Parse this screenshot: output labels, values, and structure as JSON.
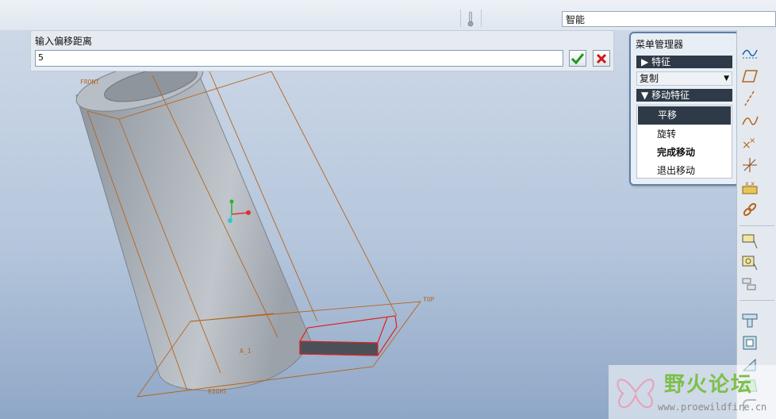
{
  "topbar": {
    "filter_value": "智能"
  },
  "offset_dialog": {
    "prompt": "输入偏移距离",
    "value": "5"
  },
  "menu_manager": {
    "title": "菜单管理器",
    "feature_header": "特征",
    "copy_option": "复制",
    "move_feature_header": "移动特征",
    "items": [
      {
        "label": "平移",
        "selected": true,
        "bold": false
      },
      {
        "label": "旋转",
        "selected": false,
        "bold": false
      },
      {
        "label": "完成移动",
        "selected": false,
        "bold": true
      },
      {
        "label": "退出移动",
        "selected": false,
        "bold": false
      }
    ]
  },
  "model": {
    "datum_labels": {
      "front": "FRONT",
      "top": "TOP",
      "right": "RIGHT",
      "axis": "A_1"
    }
  },
  "watermark": {
    "name": "野火论坛",
    "url": "www.proewildfire.cn"
  },
  "colors": {
    "datum_plane": "#b5651d",
    "highlight": "#e02020",
    "menu_dark": "#2f3a48",
    "accent_green": "#7dbf4a"
  },
  "icons": [
    "thermometer-icon",
    "check-icon",
    "close-icon",
    "sketch-curve-icon",
    "datum-plane-icon",
    "datum-axis-icon",
    "datum-curve-icon",
    "datum-point-icon",
    "coordinate-system-icon",
    "analysis-icon",
    "chain-icon",
    "extrude-icon",
    "revolve-icon",
    "sweep-icon",
    "hole-icon",
    "shell-icon",
    "rib-icon",
    "draft-icon",
    "round-icon"
  ]
}
